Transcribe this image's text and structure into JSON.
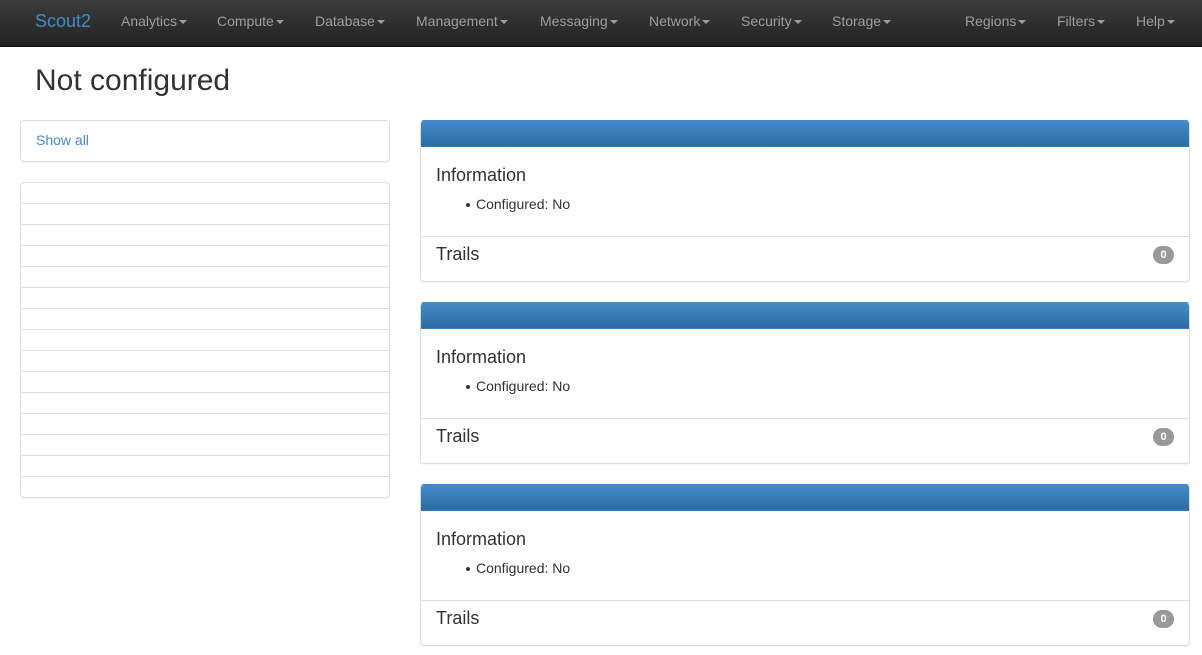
{
  "navbar": {
    "brand": "Scout2",
    "menus": [
      "Analytics",
      "Compute",
      "Database",
      "Management",
      "Messaging",
      "Network",
      "Security",
      "Storage"
    ],
    "right_menus": [
      "Regions",
      "Filters",
      "Help"
    ]
  },
  "page": {
    "title": "Not configured"
  },
  "sidebar": {
    "show_all": "Show all",
    "list_rows": 15
  },
  "services": [
    {
      "info_title": "Information",
      "configured_label": "Configured: No",
      "trails_label": "Trails",
      "trails_count": "0"
    },
    {
      "info_title": "Information",
      "configured_label": "Configured: No",
      "trails_label": "Trails",
      "trails_count": "0"
    },
    {
      "info_title": "Information",
      "configured_label": "Configured: No",
      "trails_label": "Trails",
      "trails_count": "0"
    }
  ],
  "colors": {
    "navbar": "#222222",
    "link": "#428bca",
    "panel_heading": "#428bca",
    "badge": "#999999"
  }
}
